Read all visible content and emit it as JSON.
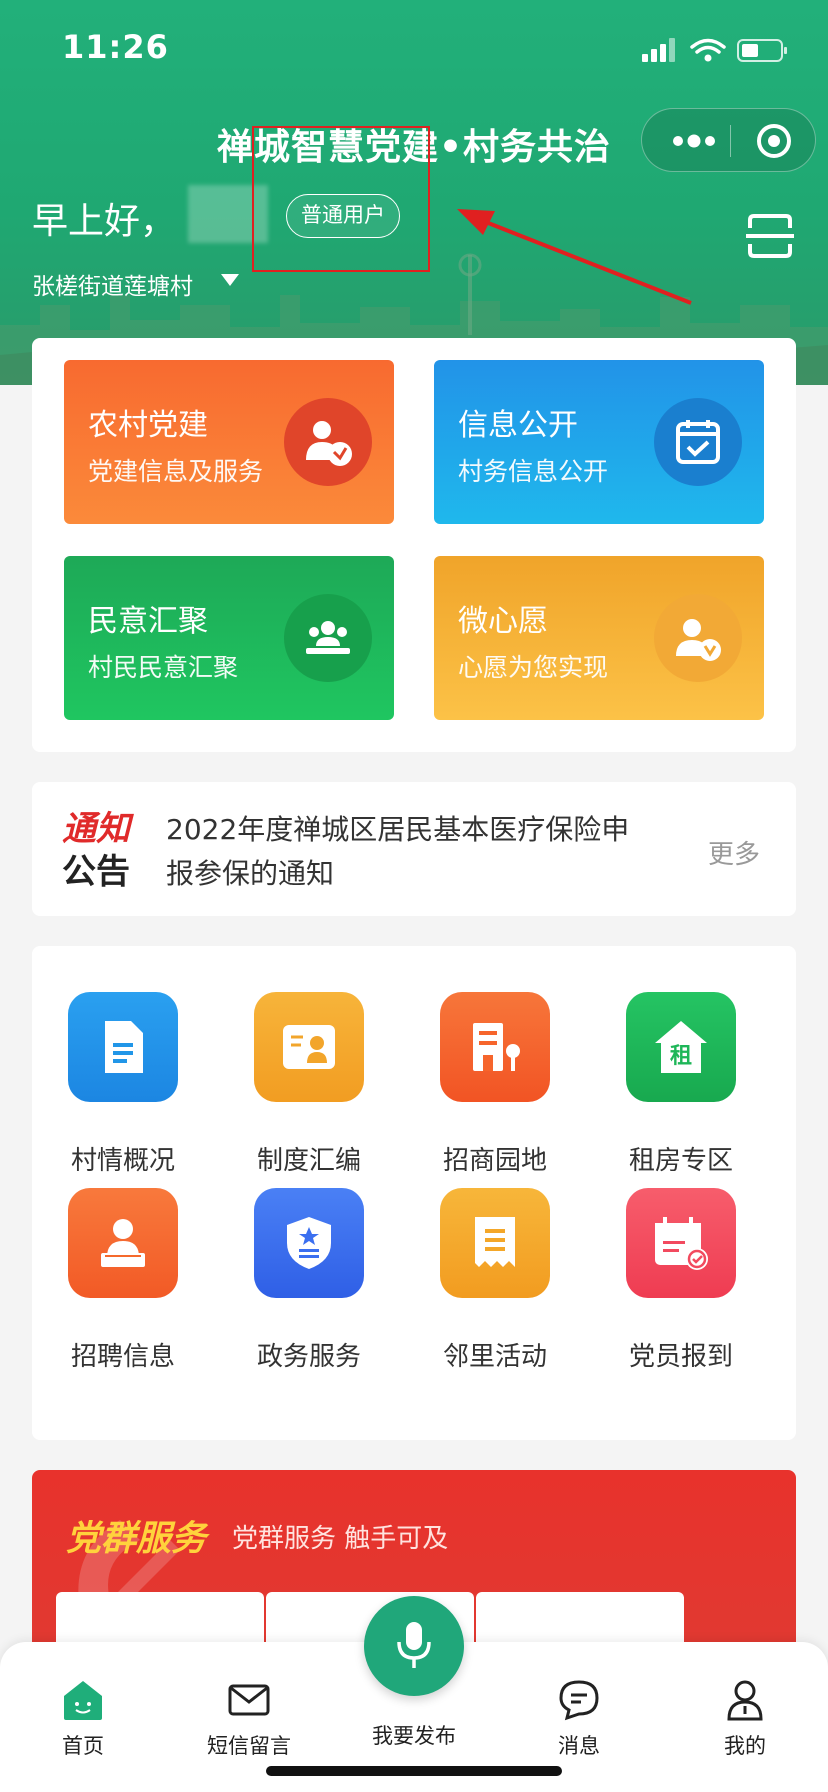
{
  "status_bar": {
    "time": "11:26"
  },
  "header": {
    "app_title": "禅城智慧党建•村务共治",
    "greeting": "早上好，",
    "user_badge": "普通用户",
    "location": "张槎街道莲塘村"
  },
  "quick_tiles": [
    {
      "title": "农村党建",
      "subtitle": "党建信息及服务",
      "icon": "party-user-icon"
    },
    {
      "title": "信息公开",
      "subtitle": "村务信息公开",
      "icon": "calendar-check-icon"
    },
    {
      "title": "民意汇聚",
      "subtitle": "村民民意汇聚",
      "icon": "group-icon"
    },
    {
      "title": "微心愿",
      "subtitle": "心愿为您实现",
      "icon": "user-check-icon"
    }
  ],
  "notice": {
    "logo_line1": "通知",
    "logo_line2": "公告",
    "text": "2022年度禅城区居民基本医疗保险申报参保的通知",
    "more": "更多"
  },
  "services": [
    {
      "label": "村情概况",
      "icon": "document-icon",
      "color": "#2196e8"
    },
    {
      "label": "制度汇编",
      "icon": "id-card-icon",
      "color": "#f2a52b"
    },
    {
      "label": "招商园地",
      "icon": "building-icon",
      "color": "#f6652c"
    },
    {
      "label": "租房专区",
      "icon": "rent-house-icon",
      "color": "#1eb658"
    },
    {
      "label": "招聘信息",
      "icon": "worker-icon",
      "color": "#f5692c"
    },
    {
      "label": "政务服务",
      "icon": "shield-icon",
      "color": "#3b6ff0"
    },
    {
      "label": "邻里活动",
      "icon": "receipt-icon",
      "color": "#f4a729"
    },
    {
      "label": "党员报到",
      "icon": "calendar-check-icon",
      "color": "#f24a5f"
    }
  ],
  "party_section": {
    "title": "党群服务",
    "subtitle": "党群服务 触手可及"
  },
  "tabbar": {
    "home": "首页",
    "sms": "短信留言",
    "publish": "我要发布",
    "messages": "消息",
    "mine": "我的"
  },
  "colors": {
    "header_green": "#22b07a",
    "party_red": "#e8322c",
    "annotation_red": "#e02020"
  }
}
